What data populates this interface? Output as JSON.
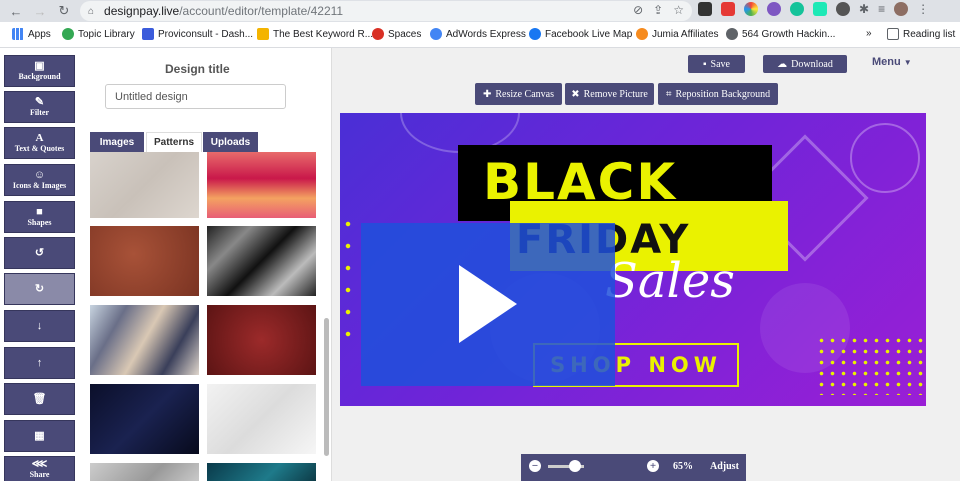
{
  "browser": {
    "url_host": "designpay.live",
    "url_path": "/account/editor/template/42211",
    "bookmarks": [
      {
        "label": "Apps",
        "color": "#4285f4"
      },
      {
        "label": "Topic Library",
        "color": "#34a853"
      },
      {
        "label": "Proviconsult - Dash...",
        "color": "#3b5bdb"
      },
      {
        "label": "The Best Keyword R...",
        "color": "#f4b400"
      },
      {
        "label": "Spaces",
        "color": "#d93025"
      },
      {
        "label": "AdWords Express",
        "color": "#4285f4"
      },
      {
        "label": "Facebook Live Map",
        "color": "#1877f2"
      },
      {
        "label": "Jumia Affiliates",
        "color": "#f68b1e"
      },
      {
        "label": "564 Growth Hackin...",
        "color": "#5f6368"
      },
      {
        "label": "Reading list",
        "color": "#5f6368"
      }
    ],
    "more": "»"
  },
  "tools": [
    {
      "label": "Background",
      "glyph": "▣"
    },
    {
      "label": "Filter",
      "glyph": "✎"
    },
    {
      "label": "Text & Quotes",
      "glyph": "A"
    },
    {
      "label": "Icons & Images",
      "glyph": "☺"
    },
    {
      "label": "Shapes",
      "glyph": "■"
    },
    {
      "label": "",
      "glyph": "↺"
    },
    {
      "label": "",
      "glyph": "↻"
    },
    {
      "label": "",
      "glyph": "↓"
    },
    {
      "label": "",
      "glyph": "↑"
    },
    {
      "label": "",
      "glyph": "🗑"
    },
    {
      "label": "",
      "glyph": "▦"
    },
    {
      "label": "Share",
      "glyph": "⋘"
    }
  ],
  "panel": {
    "title": "Design title",
    "title_value": "Untitled design",
    "tabs": [
      "Images",
      "Patterns",
      "Uploads"
    ],
    "active_tab": "Patterns"
  },
  "toolbar": {
    "save": "Save",
    "download": "Download",
    "menu": "Menu",
    "resize": "Resize Canvas",
    "remove": "Remove Picture",
    "reposition": "Reposition Background"
  },
  "canvas": {
    "line1": "BLACK",
    "line2": "FRIDAY",
    "line3": "Sales",
    "cta": "SHOP NOW"
  },
  "zoom": {
    "minus": "−",
    "plus": "+",
    "level": "65%",
    "adjust": "Adjust"
  }
}
